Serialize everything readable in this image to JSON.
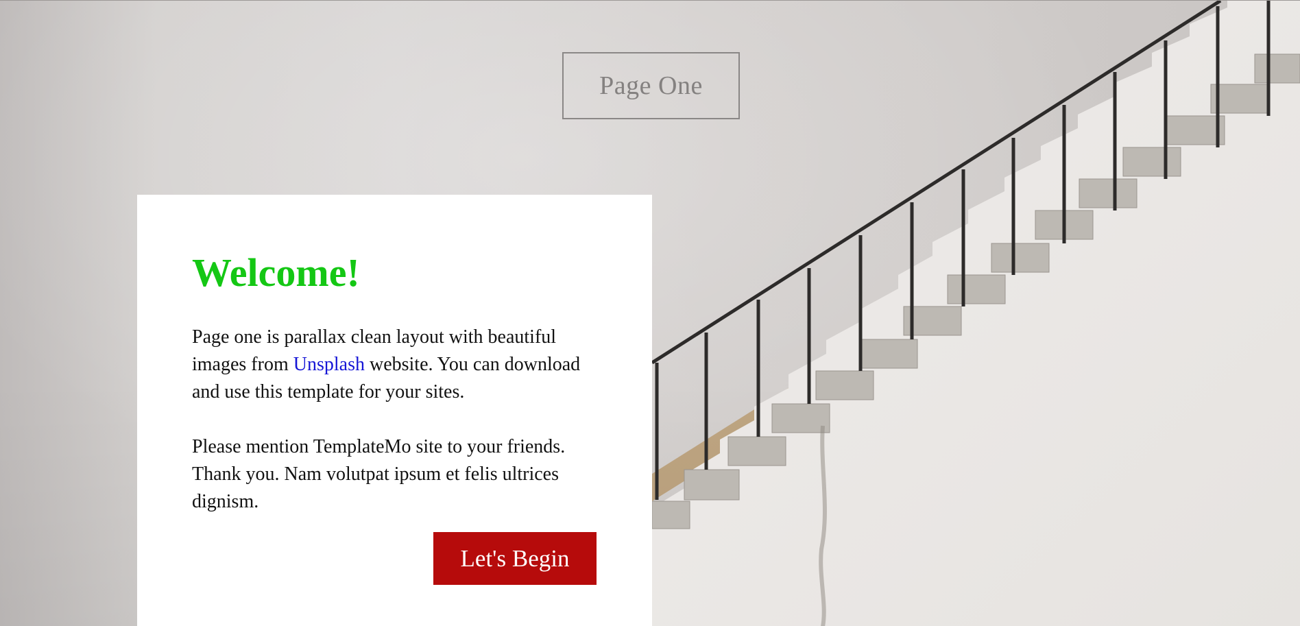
{
  "header": {
    "logo_text": "Page One"
  },
  "welcome": {
    "title": "Welcome!",
    "p1_before_link": "Page one is parallax clean layout with beautiful images from ",
    "p1_link": "Unsplash",
    "p1_after_link": " website. You can download and use this template for your sites.",
    "p2": "Please mention TemplateMo site to your friends. Thank you. Nam volutpat ipsum et felis ultrices dignism.",
    "button_label": "Let's Begin"
  },
  "colors": {
    "title_green": "#14c714",
    "button_red": "#b60b0b",
    "link_blue": "#1515d6"
  }
}
